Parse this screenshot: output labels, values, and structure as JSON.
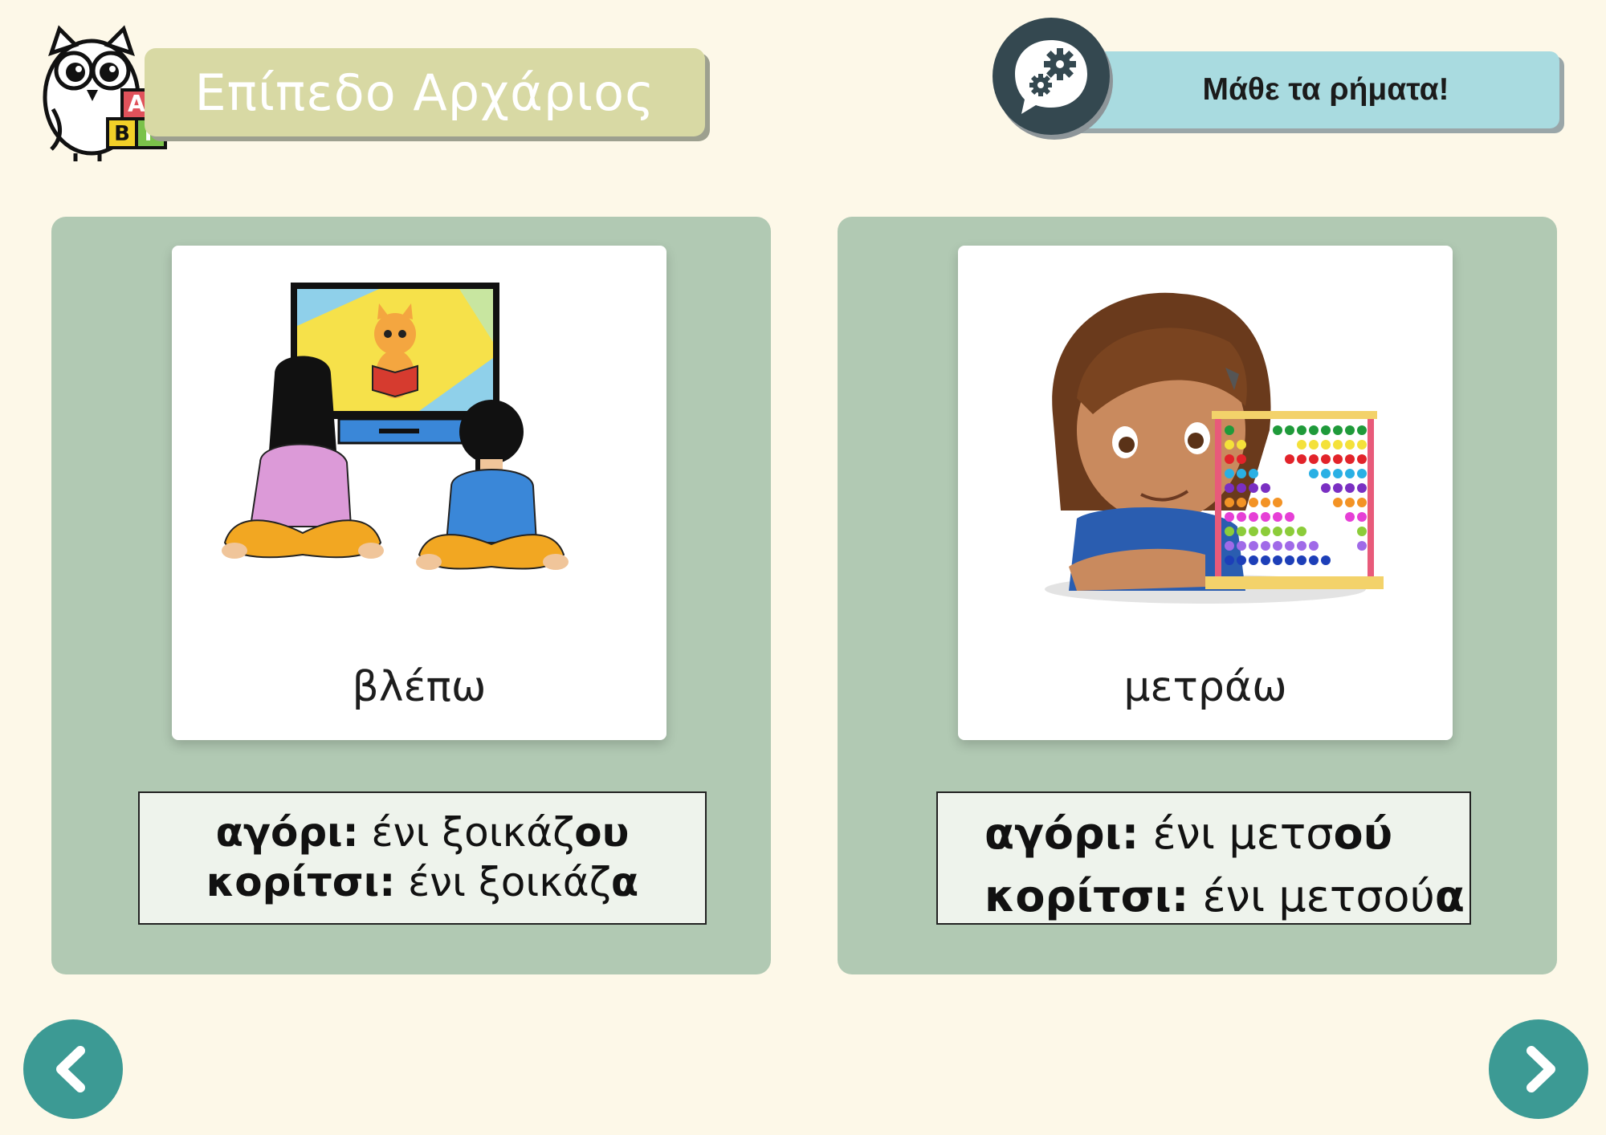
{
  "header": {
    "level_title": "Επίπεδο Αρχάριος",
    "activity_title": "Μάθε τα ρήματα!",
    "logo_blocks": [
      "Α",
      "Β",
      "Γ"
    ]
  },
  "cards": [
    {
      "word": "βλέπω",
      "illustration": "children-watching-tv",
      "boy_label": "αγόρι:",
      "boy_stem": " ένι ξοικάζ",
      "boy_ending": "ου",
      "girl_label": "κορίτσι:",
      "girl_stem": " ένι ξοικάζ",
      "girl_ending": "α"
    },
    {
      "word": "μετράω",
      "illustration": "girl-with-abacus",
      "boy_label": "αγόρι:",
      "boy_stem": " ένι μετσ",
      "boy_ending": "ού",
      "girl_label": "κορίτσι:",
      "girl_stem": " ένι μετσού",
      "girl_ending": "α"
    }
  ],
  "navigation": {
    "prev_icon": "chevron-left-icon",
    "next_icon": "chevron-right-icon"
  },
  "colors": {
    "background": "#fdf8e8",
    "panel": "#b1c9b3",
    "level_banner": "#d8d9a4",
    "activity_banner": "#a9dbe0",
    "nav_button": "#3c9a94",
    "gear_badge": "#344850"
  }
}
